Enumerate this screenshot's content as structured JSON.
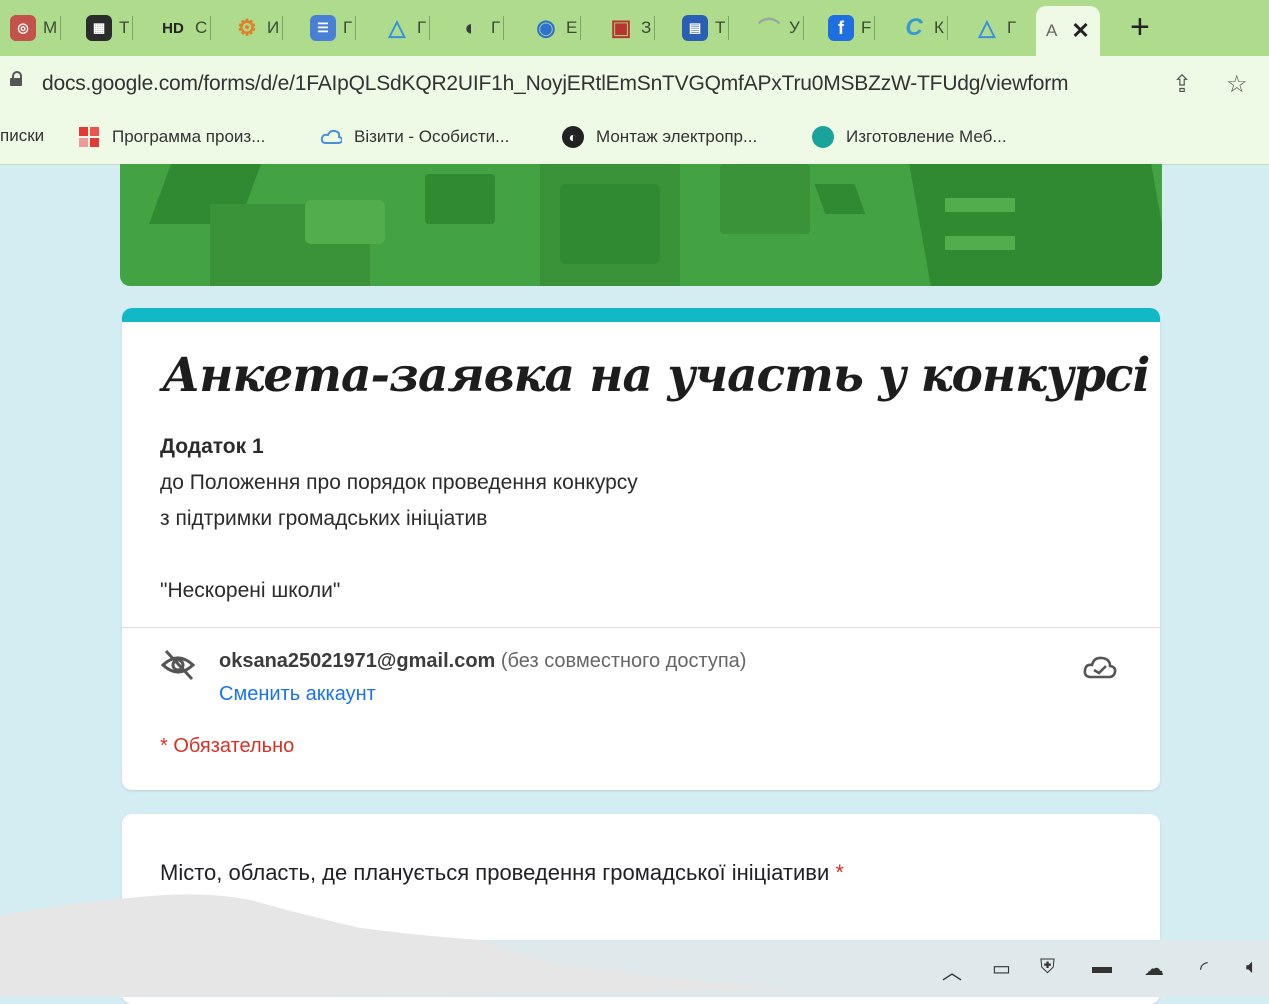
{
  "tabs": [
    {
      "letter": "М",
      "color": "#c2524a",
      "glyph": "◎"
    },
    {
      "letter": "Т",
      "color": "#2b2b2b",
      "glyph": "▦"
    },
    {
      "letter": "C",
      "color": "#ffffff",
      "glyph": "HD"
    },
    {
      "letter": "И",
      "color": "#e0802a",
      "glyph": "⚙"
    },
    {
      "letter": "Г",
      "color": "#4a7fd6",
      "glyph": "☰"
    },
    {
      "letter": "Г",
      "color": "#3a8fe0",
      "glyph": "△"
    },
    {
      "letter": "Г",
      "color": "#3b3b3b",
      "glyph": "◐"
    },
    {
      "letter": "Е",
      "color": "#2f6fd0",
      "glyph": "◉"
    },
    {
      "letter": "З",
      "color": "#b8342e",
      "glyph": "▣"
    },
    {
      "letter": "Т",
      "color": "#2a5fb5",
      "glyph": "▤"
    },
    {
      "letter": "У",
      "color": "#9aa6a0",
      "glyph": "⌒"
    },
    {
      "letter": "F",
      "color": "#1f6fe0",
      "glyph": "f"
    },
    {
      "letter": "К",
      "color": "#3a9ad0",
      "glyph": "C"
    },
    {
      "letter": "Г",
      "color": "#3a8fe0",
      "glyph": "△"
    }
  ],
  "active_tab": {
    "label": "A"
  },
  "address": {
    "url": "docs.google.com/forms/d/e/1FAIpQLSdKQR2UIF1h_NoyjERtlEmSnTVGQmfAPxTru0MSBZzW-TFUdg/viewform"
  },
  "bookmarks": [
    {
      "label": "писки"
    },
    {
      "label": "Программа произ..."
    },
    {
      "label": "Візити - Особисти..."
    },
    {
      "label": "Монтаж электропр..."
    },
    {
      "label": "Изготовление Меб..."
    }
  ],
  "form": {
    "title": "Анкета-заявка на участь у конкурсі",
    "desc_line1": "Додаток 1",
    "desc_line2": "до Положення про порядок проведення конкурсу",
    "desc_line3": "з підтримки громадських ініціатив",
    "desc_line4": "\"Нескорені школи\"",
    "email": "oksana25021971@gmail.com",
    "not_shared": "(без совместного доступа)",
    "switch_account": "Сменить аккаунт",
    "required_note": "* Обязательно",
    "question1": "Місто, область, де планується проведення громадської ініціативи",
    "required_star": "*"
  },
  "colors": {
    "tabbar": "#aedb8c",
    "header_green": "#43a342",
    "accent_teal": "#11b8c6",
    "required_red": "#d93025",
    "link_blue": "#1a73e8"
  }
}
